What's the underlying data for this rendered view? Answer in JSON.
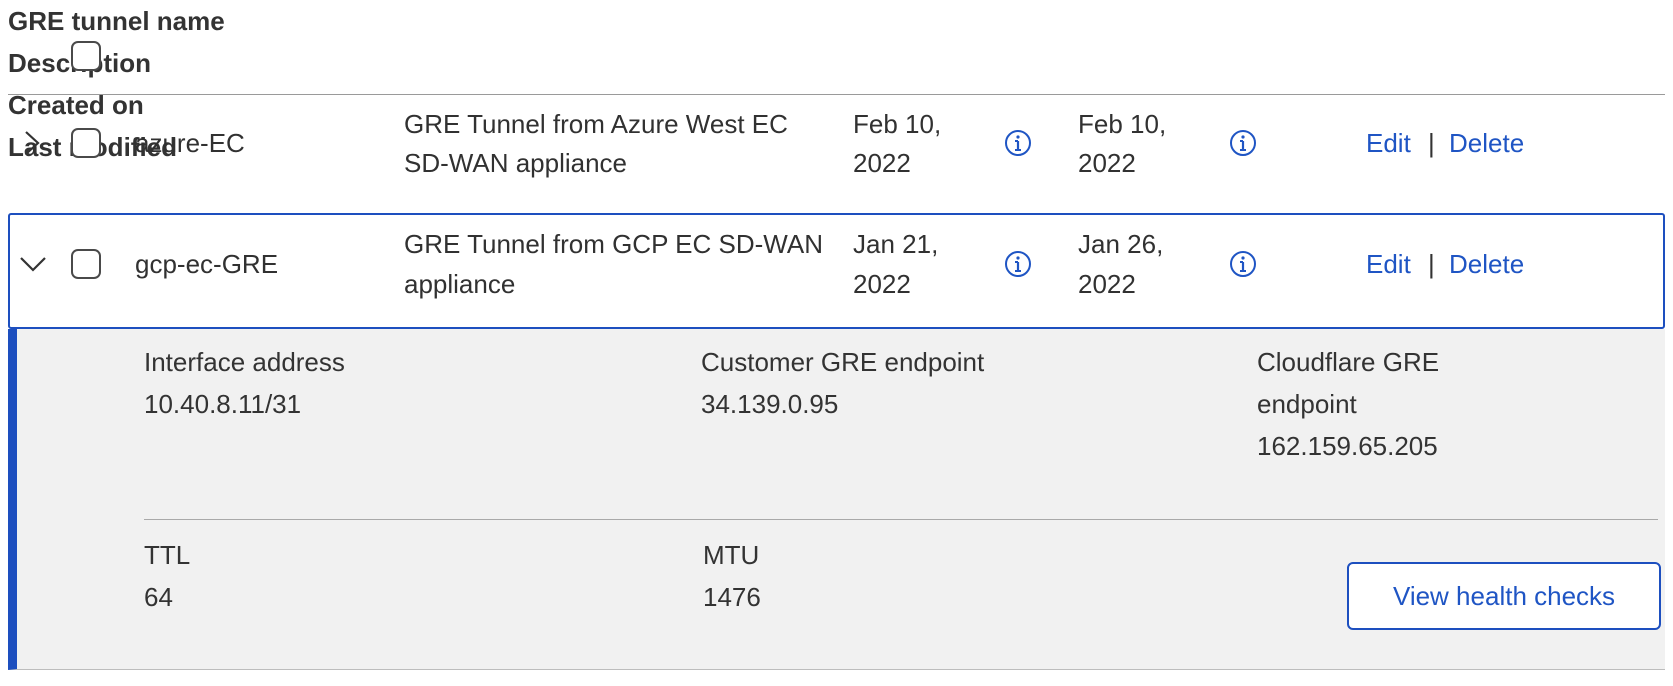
{
  "table": {
    "headers": {
      "name": "GRE tunnel name",
      "description": "Description",
      "created_on": "Created on",
      "last_modified": "Last modified"
    },
    "rows": [
      {
        "expanded": false,
        "name": "azure-EC",
        "description_line1": "GRE Tunnel from Azure West EC",
        "description_line2": "SD-WAN appliance",
        "created_line1": "Feb 10,",
        "created_line2": "2022",
        "modified_line1": "Feb 10,",
        "modified_line2": "2022",
        "edit_label": "Edit",
        "separator": "|",
        "delete_label": "Delete"
      },
      {
        "expanded": true,
        "name": "gcp-ec-GRE",
        "description_line1": "GRE Tunnel from GCP EC SD-WAN",
        "description_line2": "appliance",
        "created_line1": "Jan 21,",
        "created_line2": "2022",
        "modified_line1": "Jan 26,",
        "modified_line2": "2022",
        "edit_label": "Edit",
        "separator": "|",
        "delete_label": "Delete"
      }
    ]
  },
  "details": {
    "interface_address_label": "Interface address",
    "interface_address_value": "10.40.8.11/31",
    "customer_endpoint_label": "Customer GRE endpoint",
    "customer_endpoint_value": "34.139.0.95",
    "cloudflare_endpoint_label_line1": "Cloudflare GRE",
    "cloudflare_endpoint_label_line2": "endpoint",
    "cloudflare_endpoint_value": "162.159.65.205",
    "ttl_label": "TTL",
    "ttl_value": "64",
    "mtu_label": "MTU",
    "mtu_value": "1476",
    "health_button_label": "View health checks"
  },
  "icons": {
    "expand": "chevron-right-icon",
    "collapse": "chevron-down-icon",
    "info": "info-circle-icon"
  },
  "colors": {
    "accent": "#1f55c4",
    "border_accent": "#1d4fbf",
    "details_background": "#f1f1f1"
  }
}
